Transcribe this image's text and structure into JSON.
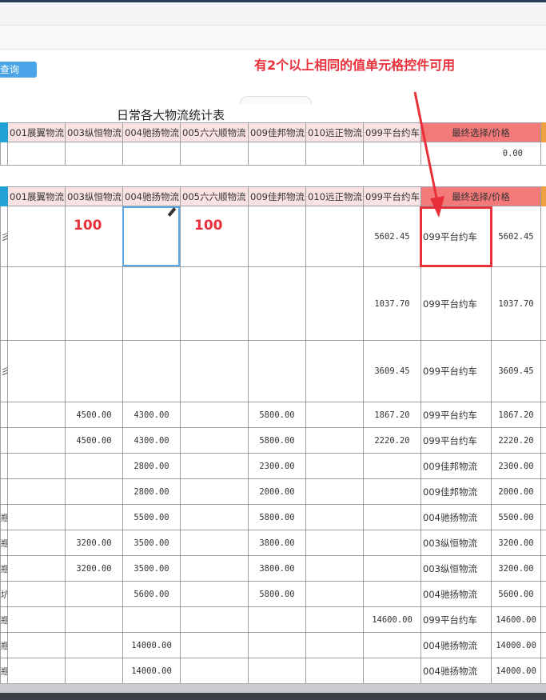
{
  "toolbar": {
    "query_label": "查询"
  },
  "annotation": "有2个以上相同的值单元格控件可用",
  "report": {
    "title": "日常各大物流统计表"
  },
  "columns": [
    "001展翼物流",
    "003纵恒物流",
    "004驰扬物流",
    "005六六顺物流",
    "009佳邦物流",
    "010远正物流",
    "099平台约车",
    "最终选择/价格"
  ],
  "summary_row": {
    "final_price": "0.00"
  },
  "typed_values": {
    "col003": "100",
    "col005": "100"
  },
  "rows": [
    {
      "edge": "彡",
      "c001": "",
      "c003": "",
      "c004": "",
      "c005": "",
      "c009": "",
      "c010": "",
      "c099": "5602.45",
      "choice": "099平台约车",
      "price": "5602.45"
    },
    {
      "edge": "",
      "c001": "",
      "c003": "",
      "c004": "",
      "c005": "",
      "c009": "",
      "c010": "",
      "c099": "1037.70",
      "choice": "099平台约车",
      "price": "1037.70"
    },
    {
      "edge": "彡",
      "c001": "",
      "c003": "",
      "c004": "",
      "c005": "",
      "c009": "",
      "c010": "",
      "c099": "3609.45",
      "choice": "099平台约车",
      "price": "3609.45"
    },
    {
      "edge": "",
      "c001": "",
      "c003": "4500.00",
      "c004": "4300.00",
      "c005": "",
      "c009": "5800.00",
      "c010": "",
      "c099": "1867.20",
      "choice": "099平台约车",
      "price": "1867.20"
    },
    {
      "edge": "",
      "c001": "",
      "c003": "4500.00",
      "c004": "4300.00",
      "c005": "",
      "c009": "5800.00",
      "c010": "",
      "c099": "2220.20",
      "choice": "099平台约车",
      "price": "2220.20"
    },
    {
      "edge": "",
      "c001": "",
      "c003": "",
      "c004": "2800.00",
      "c005": "",
      "c009": "2300.00",
      "c010": "",
      "c099": "",
      "choice": "009佳邦物流",
      "price": "2300.00"
    },
    {
      "edge": "",
      "c001": "",
      "c003": "",
      "c004": "2800.00",
      "c005": "",
      "c009": "2000.00",
      "c010": "",
      "c099": "",
      "choice": "009佳邦物流",
      "price": "2000.00"
    },
    {
      "edge": "瓶",
      "c001": "",
      "c003": "",
      "c004": "5500.00",
      "c005": "",
      "c009": "5800.00",
      "c010": "",
      "c099": "",
      "choice": "004驰扬物流",
      "price": "5500.00"
    },
    {
      "edge": "瓶",
      "c001": "",
      "c003": "3200.00",
      "c004": "3500.00",
      "c005": "",
      "c009": "3800.00",
      "c010": "",
      "c099": "",
      "choice": "003纵恒物流",
      "price": "3200.00"
    },
    {
      "edge": "瓶",
      "c001": "",
      "c003": "3200.00",
      "c004": "3500.00",
      "c005": "",
      "c009": "3800.00",
      "c010": "",
      "c099": "",
      "choice": "003纵恒物流",
      "price": "3200.00"
    },
    {
      "edge": "坑",
      "c001": "",
      "c003": "",
      "c004": "5600.00",
      "c005": "",
      "c009": "5800.00",
      "c010": "",
      "c099": "",
      "choice": "004驰扬物流",
      "price": "5600.00"
    },
    {
      "edge": "瓶",
      "c001": "",
      "c003": "",
      "c004": "",
      "c005": "",
      "c009": "",
      "c010": "",
      "c099": "14600.00",
      "choice": "099平台约车",
      "price": "14600.00"
    },
    {
      "edge": "瓶",
      "c001": "",
      "c003": "",
      "c004": "14000.00",
      "c005": "",
      "c009": "",
      "c010": "",
      "c099": "",
      "choice": "004驰扬物流",
      "price": "14000.00"
    },
    {
      "edge": "瓶",
      "c001": "",
      "c003": "",
      "c004": "14000.00",
      "c005": "",
      "c009": "",
      "c010": "",
      "c099": "",
      "choice": "004驰扬物流",
      "price": "14000.00"
    }
  ],
  "colors": {
    "annotation": "#e8303a",
    "header_bg": "#fbe3e3",
    "header_final_bg": "#f47a7a",
    "accent_cyan": "#22a3d6",
    "accent_orange": "#f0a040",
    "query_button": "#4aa5e8"
  }
}
